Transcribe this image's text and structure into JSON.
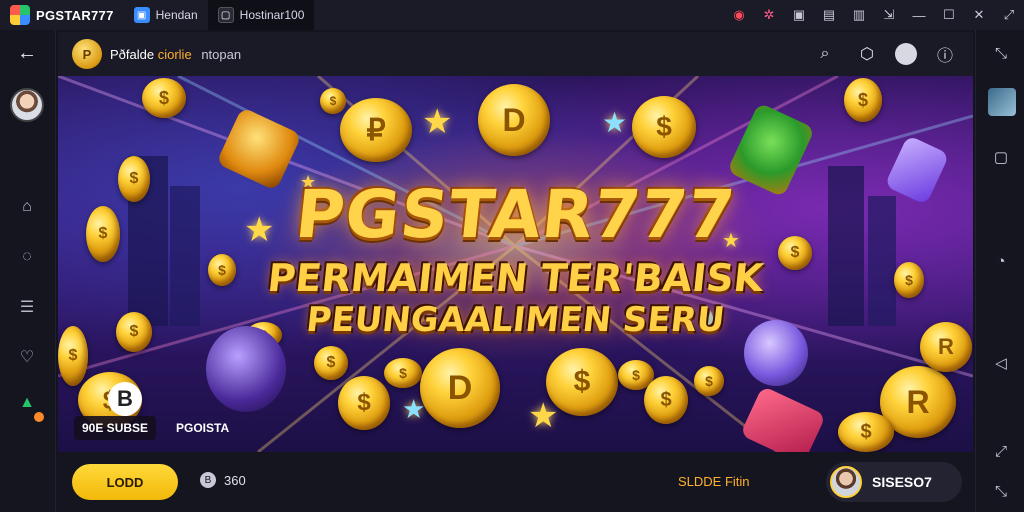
{
  "titlebar": {
    "app_name": "PGSTAR777",
    "tabs": [
      {
        "label": "Hendan",
        "icon": "app-icon"
      },
      {
        "label": "Hostinar100",
        "icon": "window-icon"
      }
    ],
    "icons": [
      "record-icon",
      "network-icon",
      "screen-icon",
      "keyboard-icon",
      "gamepad-icon",
      "export-icon",
      "minimize-icon",
      "maximize-icon",
      "close-icon"
    ]
  },
  "left_rail": {
    "icons": [
      "back-arrow-icon",
      "avatar",
      "home-icon",
      "chat-icon",
      "list-icon",
      "heart-icon",
      "gift-icon"
    ]
  },
  "right_rail": {
    "icons": [
      "expand-icon",
      "shrink-icon",
      "thumbnail",
      "square-icon",
      "brightness-icon",
      "back-triangle-icon",
      "expand-icon",
      "shrink-icon"
    ]
  },
  "header": {
    "site_logo_text": "P",
    "title_main": "Pðfalde",
    "title_accent": "ciorlie",
    "title_dim": "ntopan"
  },
  "banner": {
    "headline_1": "PGSTAR777",
    "headline_2": "PERMAIMEN TER'BAISK",
    "headline_3": "PEUNGAALIMEN SERU",
    "badge_logo": "B",
    "tag_left": "90E SUBSE",
    "tag_right": "PGOISTA"
  },
  "bottom": {
    "load_button": "LODD",
    "count_icon": "B",
    "count_value": "360",
    "slide_link": "SLDDE Fitin",
    "user_label": "SISESO7"
  },
  "colors": {
    "accent_gold": "#ffd23a",
    "accent_orange": "#ffb02e",
    "background": "#14141f"
  }
}
